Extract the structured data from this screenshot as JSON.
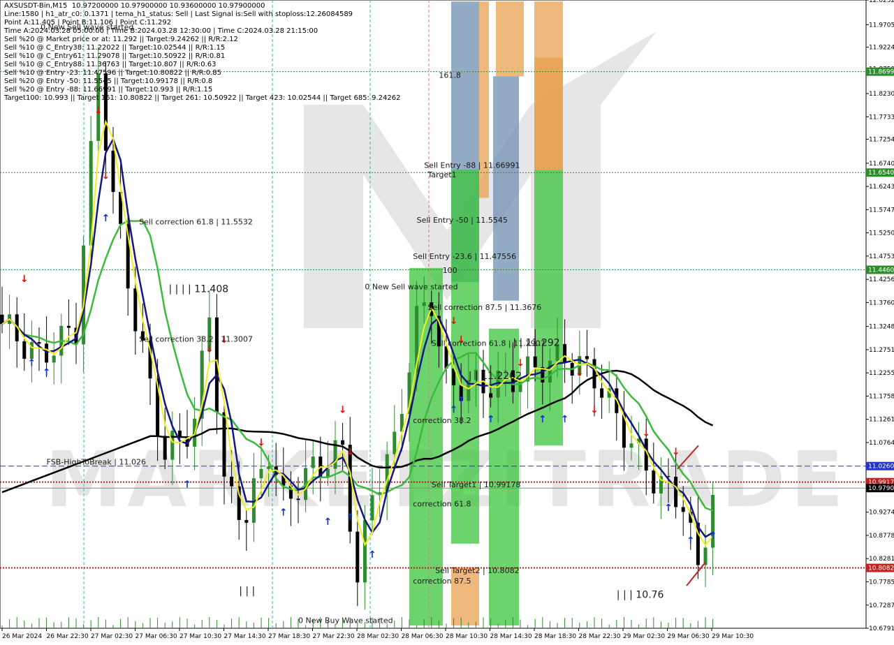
{
  "info_lines": [
    "AXSUSDT-Bin,M15  10.97200000 10.97900000 10.93600000 10.97900000",
    "Line:1580 | h1_atr_c0: 0.1371 | tema_h1_status: Sell | Last Signal is:Sell with stoploss:12.26084589",
    "Point A:11.405 | Point B:11.106 | Point C:11.292",
    "Time A:2024.03.28 05:00:00 | Time B:2024.03.28 12:30:00 | Time C:2024.03.28 21:15:00",
    "Sell %20 @ Market price or at: 11.292 || Target:9.24262 || R/R:2.12",
    "Sell %10 @ C_Entry38: 11.22022 || Target:10.02544 || R/R:1.15",
    "Sell %10 @ C_Entry61: 11.29078 || Target:10.50922 || R/R:0.81",
    "Sell %10 @ C_Entry88: 11.36763 || Target:10.807 || R/R:0.63",
    "Sell %10 @ Entry -23: 11.47596 || Target:10.80822 || R/R:0.85",
    "Sell %20 @ Entry -50: 11.5545 || Target:10.99178 || R/R:0.8",
    "Sell %20 @ Entry -88: 11.66991 || Target:10.993 || R/R:1.15",
    "Target100: 10.993 || Target 161: 10.80822 || Target 261: 10.50922 || Target 423: 10.02544 || Target 685: 9.24262"
  ],
  "chart_data": {
    "type": "candlestick",
    "symbol": "AXSUSDT-Bin",
    "timeframe": "M15",
    "ohlc_last": {
      "open": 10.972,
      "high": 10.979,
      "low": 10.936,
      "close": 10.979
    },
    "ylim": [
      10.6791,
      12.0232
    ],
    "y_ticks": [
      "12.0232",
      "11.9705",
      "11.9224",
      "11.8759",
      "11.8230",
      "11.7733",
      "11.7254",
      "11.6740",
      "11.6243",
      "11.5747",
      "11.5250",
      "11.4753",
      "11.4256",
      "11.3760",
      "11.3248",
      "11.2751",
      "11.2255",
      "11.1758",
      "11.1261",
      "11.0764",
      "11.0260",
      "10.9917",
      "10.9790",
      "10.9274",
      "10.8778",
      "10.8281",
      "10.8082",
      "10.7785",
      "10.7287",
      "10.6791"
    ],
    "x_ticks": [
      "26 Mar 2024",
      "26 Mar 22:30",
      "27 Mar 02:30",
      "27 Mar 06:30",
      "27 Mar 10:30",
      "27 Mar 14:30",
      "27 Mar 18:30",
      "27 Mar 22:30",
      "28 Mar 02:30",
      "28 Mar 06:30",
      "28 Mar 10:30",
      "28 Mar 14:30",
      "28 Mar 18:30",
      "28 Mar 22:30",
      "29 Mar 02:30",
      "29 Mar 06:30",
      "29 Mar 10:30"
    ],
    "price_tags": [
      {
        "value": 11.8699,
        "label": "11.8699",
        "color": "#2e8b2e"
      },
      {
        "value": 11.654,
        "label": "11.6540",
        "color": "#2e8b2e"
      },
      {
        "value": 11.446,
        "label": "11.4460",
        "color": "#2e8b2e"
      },
      {
        "value": 11.026,
        "label": "11.0260",
        "color": "#2233cc"
      },
      {
        "value": 10.9917,
        "label": "10.9917",
        "color": "#c02020"
      },
      {
        "value": 10.979,
        "label": "10.9790",
        "color": "#000000"
      },
      {
        "value": 10.8082,
        "label": "10.8082",
        "color": "#c02020"
      }
    ],
    "annotations": [
      {
        "text": "0 New Sell wave started",
        "at": [
          5.2,
          11.96
        ]
      },
      {
        "text": "Sell correction 61.8 | 11.5532",
        "at": [
          18.5,
          11.543
        ]
      },
      {
        "text": "| | | | 11.408",
        "at": [
          22.5,
          11.398
        ]
      },
      {
        "text": "Sell correction 38.2 | 11.3007",
        "at": [
          18.5,
          11.292
        ]
      },
      {
        "text": "FSB-HighToBreak | 11.026",
        "at": [
          6,
          11.029
        ]
      },
      {
        "text": "| | |",
        "at": [
          32,
          10.752
        ]
      },
      {
        "text": "0 New Buy Wave started",
        "at": [
          40,
          10.69
        ]
      },
      {
        "text": "0 New Sell wave started",
        "at": [
          49,
          11.404
        ]
      },
      {
        "text": "161.8",
        "at": [
          59,
          11.857
        ]
      },
      {
        "text": "Sell Entry -88 | 11.66991",
        "at": [
          57,
          11.664
        ]
      },
      {
        "text": "Target1",
        "at": [
          57.5,
          11.644
        ]
      },
      {
        "text": "Sell Entry -50 | 11.5545",
        "at": [
          56,
          11.547
        ]
      },
      {
        "text": "Sell Entry -23.6 | 11.47556",
        "at": [
          55.5,
          11.469
        ]
      },
      {
        "text": "100",
        "at": [
          59.5,
          11.439
        ]
      },
      {
        "text": "Sell correction 87.5 | 11.3676",
        "at": [
          57.5,
          11.36
        ]
      },
      {
        "text": "Sell correction 61.8 | 11.2907",
        "at": [
          58,
          11.283
        ]
      },
      {
        "text": "| | 11.292",
        "at": [
          69,
          11.283
        ]
      },
      {
        "text": "| | 11.2202",
        "at": [
          63,
          11.212
        ]
      },
      {
        "text": "correction 38.2",
        "at": [
          55.5,
          11.118
        ]
      },
      {
        "text": "correction 61.8",
        "at": [
          55.5,
          10.94
        ]
      },
      {
        "text": "correction 87.5",
        "at": [
          55.5,
          10.775
        ]
      },
      {
        "text": "Sell Target1 | 10.99178",
        "at": [
          58,
          10.981
        ]
      },
      {
        "text": "Sell Target2 | 10.8082",
        "at": [
          58.5,
          10.797
        ]
      },
      {
        "text": "| | | 10.76",
        "at": [
          83,
          10.744
        ]
      }
    ]
  },
  "colors": {
    "background": "#ffffff",
    "bull_candle": "#2e8b2e",
    "bear_candle": "#000000",
    "ma_black": "#000000",
    "ma_green": "#3cba3c",
    "ma_navy": "#16167a",
    "ma_yellow": "#f2ee22",
    "grid_green": "#2e8b2e",
    "line_blue": "#2233cc",
    "line_red": "#c02020",
    "arrow_down": "#e01010",
    "arrow_up": "#1530d0",
    "box_green": "#3cc63c",
    "box_orange": "#e8a050",
    "box_blue": "#6f8fb0"
  }
}
